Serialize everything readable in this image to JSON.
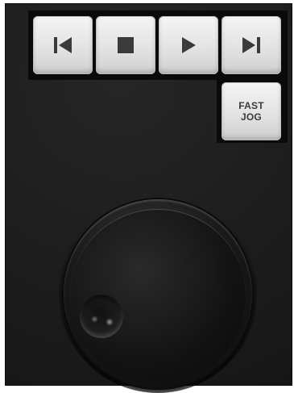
{
  "transport": {
    "buttons": [
      {
        "id": "skip-back",
        "icon": "skip-back-icon",
        "label": ""
      },
      {
        "id": "stop",
        "icon": "stop-icon",
        "label": ""
      },
      {
        "id": "play",
        "icon": "play-icon",
        "label": ""
      },
      {
        "id": "skip-forward",
        "icon": "skip-forward-icon",
        "label": ""
      }
    ]
  },
  "fast_jog": {
    "line1": "FAST",
    "line2": "JOG",
    "icon": "none"
  },
  "jog_wheel": {
    "icon": "jog-wheel",
    "has_finger_dimple": true
  },
  "colors": {
    "panel": "#1f1f1f",
    "key_face": "#e6e6e6",
    "glyph": "#3a3a3a",
    "wheel": "#111111"
  }
}
